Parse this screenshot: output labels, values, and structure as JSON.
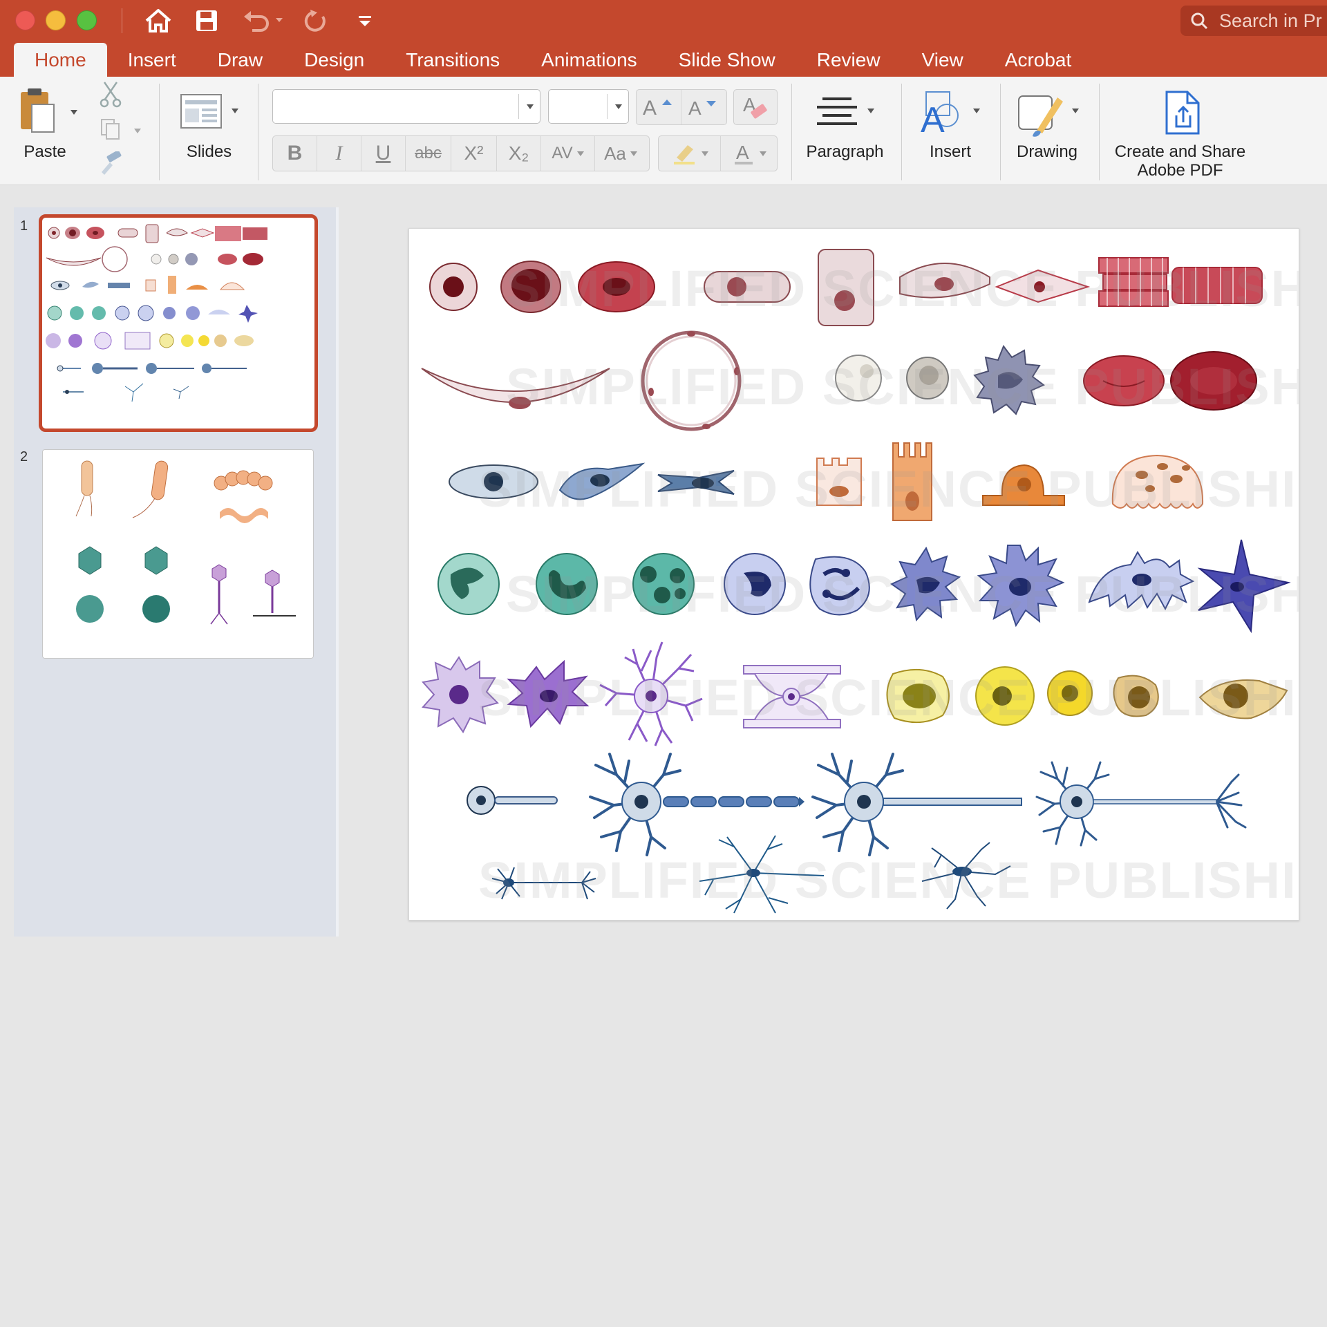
{
  "quick_access": {
    "home": "home-icon",
    "save": "save-icon",
    "undo": "undo-icon",
    "redo": "redo-icon",
    "customize": "customize-toolbar-icon"
  },
  "search": {
    "placeholder": "Search in Pr"
  },
  "tabs": [
    {
      "label": "Home",
      "active": true
    },
    {
      "label": "Insert"
    },
    {
      "label": "Draw"
    },
    {
      "label": "Design"
    },
    {
      "label": "Transitions"
    },
    {
      "label": "Animations"
    },
    {
      "label": "Slide Show"
    },
    {
      "label": "Review"
    },
    {
      "label": "View"
    },
    {
      "label": "Acrobat"
    }
  ],
  "ribbon": {
    "paste_label": "Paste",
    "slides_label": "Slides",
    "font_name": "",
    "font_size": "",
    "format_buttons": [
      "B",
      "I",
      "U",
      "abc",
      "X²",
      "X₂",
      "AV",
      "Aa"
    ],
    "paragraph_label": "Paragraph",
    "insert_label": "Insert",
    "drawing_label": "Drawing",
    "pdf_label_line1": "Create and Share",
    "pdf_label_line2": "Adobe PDF"
  },
  "slides_pane": {
    "slide_numbers": [
      "1",
      "2"
    ],
    "selected": 1
  },
  "slide": {
    "watermark": "SIMPLIFIED SCIENCE PUBLISHING"
  },
  "colors": {
    "accent": "#c4482d",
    "ribbon_bg": "#f4f4f4",
    "pane_bg": "#dde1e9",
    "workspace_bg": "#e6e6e6"
  }
}
